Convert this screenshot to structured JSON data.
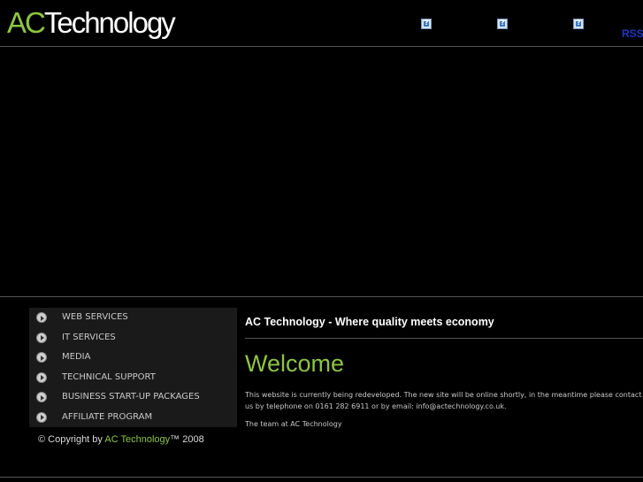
{
  "header": {
    "logo_ac": "AC",
    "logo_tech": "Technology",
    "rss_label": "RSS"
  },
  "nav": {
    "items": [
      {
        "label": "WEB SERVICES"
      },
      {
        "label": "IT SERVICES"
      },
      {
        "label": "MEDIA"
      },
      {
        "label": "TECHNICAL SUPPORT"
      },
      {
        "label": "BUSINESS START-UP PACKAGES"
      },
      {
        "label": "AFFILIATE PROGRAM"
      }
    ]
  },
  "footer": {
    "copyright_prefix": "© Copyright by ",
    "copyright_brand": "AC Technology",
    "copyright_suffix": "™ 2008"
  },
  "main": {
    "tagline": "AC Technology - Where quality meets economy",
    "heading": "Welcome",
    "paragraph_line1": "This website is currently being redeveloped. The new site will be online shortly, in the meantime please contact",
    "paragraph_line2": "us by telephone on 0161 282 6911 or by email: info@actechnology.co.uk.",
    "signoff": "The team at AC Technology"
  },
  "colors": {
    "accent": "#8cc63f",
    "background": "#000000",
    "rss": "#1b36c7"
  }
}
